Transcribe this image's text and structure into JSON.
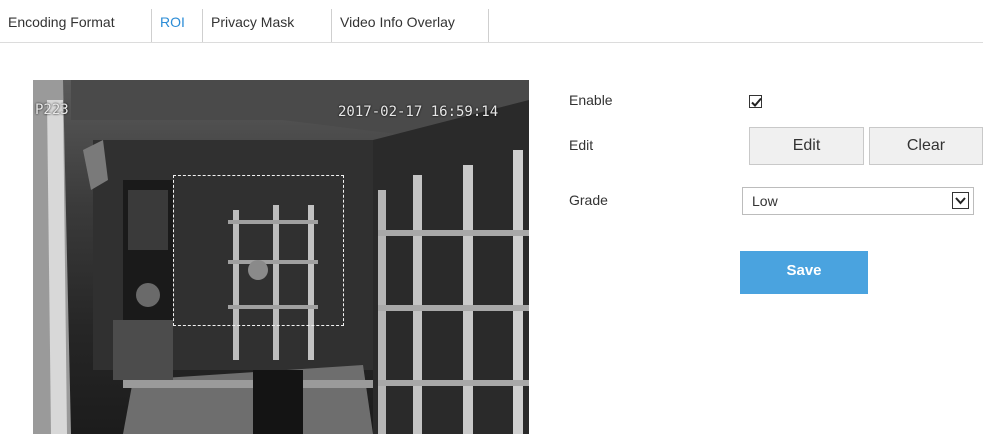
{
  "tabs": [
    {
      "label": "Encoding Format",
      "active": false
    },
    {
      "label": "ROI",
      "active": true
    },
    {
      "label": "Privacy Mask",
      "active": false
    },
    {
      "label": "Video Info Overlay",
      "active": false
    }
  ],
  "video": {
    "osd_camera_label": "P223",
    "osd_timestamp": "2017-02-17 16:59:14"
  },
  "form": {
    "enable_label": "Enable",
    "enable_checked": true,
    "edit_label": "Edit",
    "edit_button": "Edit",
    "clear_button": "Clear",
    "grade_label": "Grade",
    "grade_value": "Low",
    "save_button": "Save"
  },
  "colors": {
    "accent": "#2b8cd6",
    "save_button_bg": "#4aa3df"
  }
}
